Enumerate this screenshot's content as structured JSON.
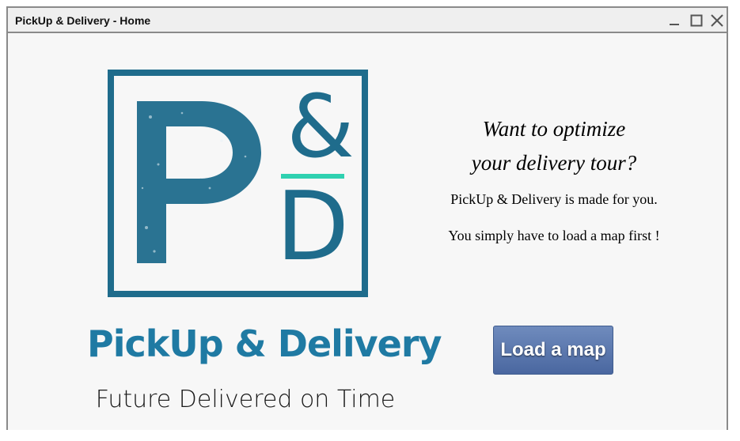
{
  "window": {
    "title": "PickUp & Delivery - Home",
    "controls": [
      "minimize-icon",
      "maximize-icon",
      "close-icon"
    ]
  },
  "logo": {
    "monogram": "P&D",
    "name": "PickUp & Delivery",
    "tagline": "Future Delivered on Time",
    "colors": {
      "brand_blue": "#1f6c8c",
      "brand_text_blue": "#1f7aa3",
      "accent_teal": "#2fd1b0"
    }
  },
  "intro": {
    "headline_line1": "Want to optimize",
    "headline_line2": "your delivery tour?",
    "paragraph1": "PickUp & Delivery is made for you.",
    "paragraph2": "You simply have to load a map first !"
  },
  "actions": {
    "load_map_label": "Load a map",
    "button_color": "#5a76ab"
  }
}
